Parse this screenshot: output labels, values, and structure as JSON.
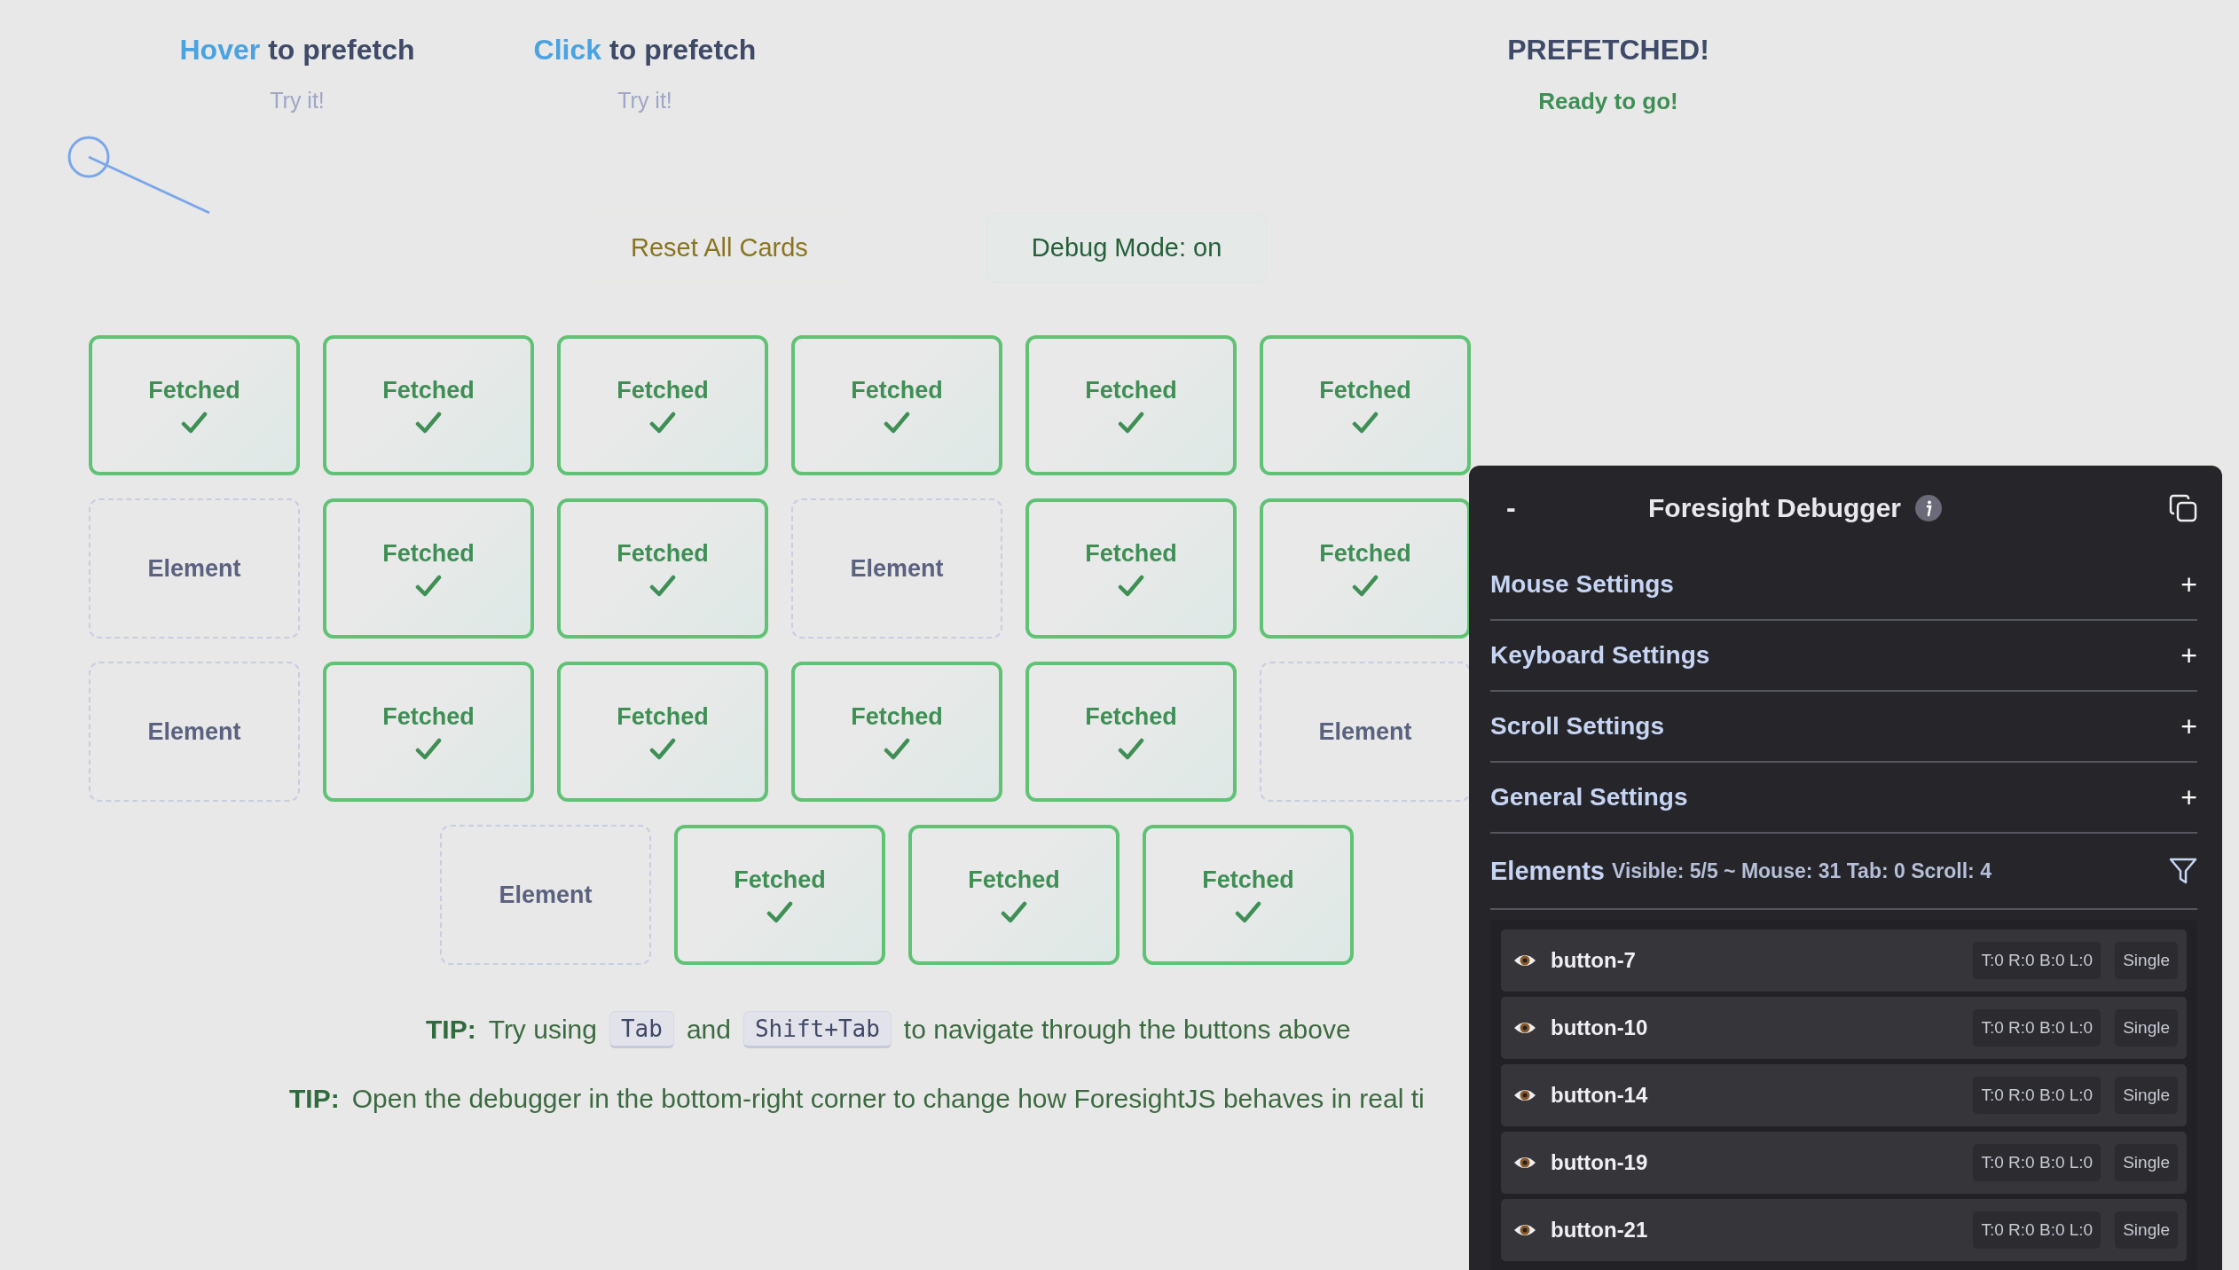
{
  "demos": [
    {
      "kind": "action",
      "action": "Hover",
      "title": "to prefetch",
      "hint": "Try it!"
    },
    {
      "kind": "action",
      "action": "Click",
      "title": "to prefetch",
      "hint": "Try it!"
    },
    {
      "kind": "status",
      "title": "PREFETCHED!",
      "hint": "Ready to go!"
    }
  ],
  "controls": [
    {
      "kind": "reset",
      "label": "Reset All Cards"
    },
    {
      "kind": "debug",
      "label": "Debug Mode: on"
    }
  ],
  "cards": [
    [
      {
        "label": "Fetched",
        "fetched": true
      },
      {
        "label": "Fetched",
        "fetched": true
      },
      {
        "label": "Fetched",
        "fetched": true
      },
      {
        "label": "Fetched",
        "fetched": true
      },
      {
        "label": "Fetched",
        "fetched": true
      },
      {
        "label": "Fetched",
        "fetched": true
      }
    ],
    [
      {
        "label": "Element",
        "fetched": false
      },
      {
        "label": "Fetched",
        "fetched": true
      },
      {
        "label": "Fetched",
        "fetched": true
      },
      {
        "label": "Element",
        "fetched": false
      },
      {
        "label": "Fetched",
        "fetched": true
      },
      {
        "label": "Fetched",
        "fetched": true
      }
    ],
    [
      {
        "label": "Element",
        "fetched": false
      },
      {
        "label": "Fetched",
        "fetched": true
      },
      {
        "label": "Fetched",
        "fetched": true
      },
      {
        "label": "Fetched",
        "fetched": true
      },
      {
        "label": "Fetched",
        "fetched": true
      },
      {
        "label": "Element",
        "fetched": false
      }
    ],
    [
      {
        "label": "Element",
        "fetched": false
      },
      {
        "label": "Fetched",
        "fetched": true
      },
      {
        "label": "Fetched",
        "fetched": true
      },
      {
        "label": "Fetched",
        "fetched": true
      }
    ]
  ],
  "tips": [
    {
      "lead": "TIP:",
      "parts": [
        {
          "kind": "text",
          "text": "Try using"
        },
        {
          "kind": "key",
          "text": "Tab"
        },
        {
          "kind": "text",
          "text": "and"
        },
        {
          "kind": "key",
          "text": "Shift+Tab"
        },
        {
          "kind": "text",
          "text": "to navigate through the buttons above"
        }
      ]
    },
    {
      "lead": "TIP:",
      "parts": [
        {
          "kind": "text",
          "text": "Open the debugger in the bottom-right corner to change how ForesightJS behaves in real ti"
        }
      ]
    }
  ],
  "debugger": {
    "collapse": "-",
    "title": "Foresight Debugger",
    "sections": [
      {
        "label": "Mouse Settings",
        "toggle": "+"
      },
      {
        "label": "Keyboard Settings",
        "toggle": "+"
      },
      {
        "label": "Scroll Settings",
        "toggle": "+"
      },
      {
        "label": "General Settings",
        "toggle": "+"
      }
    ],
    "elements": {
      "label": "Elements",
      "summary": "Visible: 5/5 ~ Mouse: 31 Tab: 0 Scroll: 4",
      "items": [
        {
          "name": "button-7",
          "bounds": "T:0 R:0 B:0 L:0",
          "mode": "Single"
        },
        {
          "name": "button-10",
          "bounds": "T:0 R:0 B:0 L:0",
          "mode": "Single"
        },
        {
          "name": "button-14",
          "bounds": "T:0 R:0 B:0 L:0",
          "mode": "Single"
        },
        {
          "name": "button-19",
          "bounds": "T:0 R:0 B:0 L:0",
          "mode": "Single"
        },
        {
          "name": "button-21",
          "bounds": "T:0 R:0 B:0 L:0",
          "mode": "Single"
        }
      ]
    }
  }
}
